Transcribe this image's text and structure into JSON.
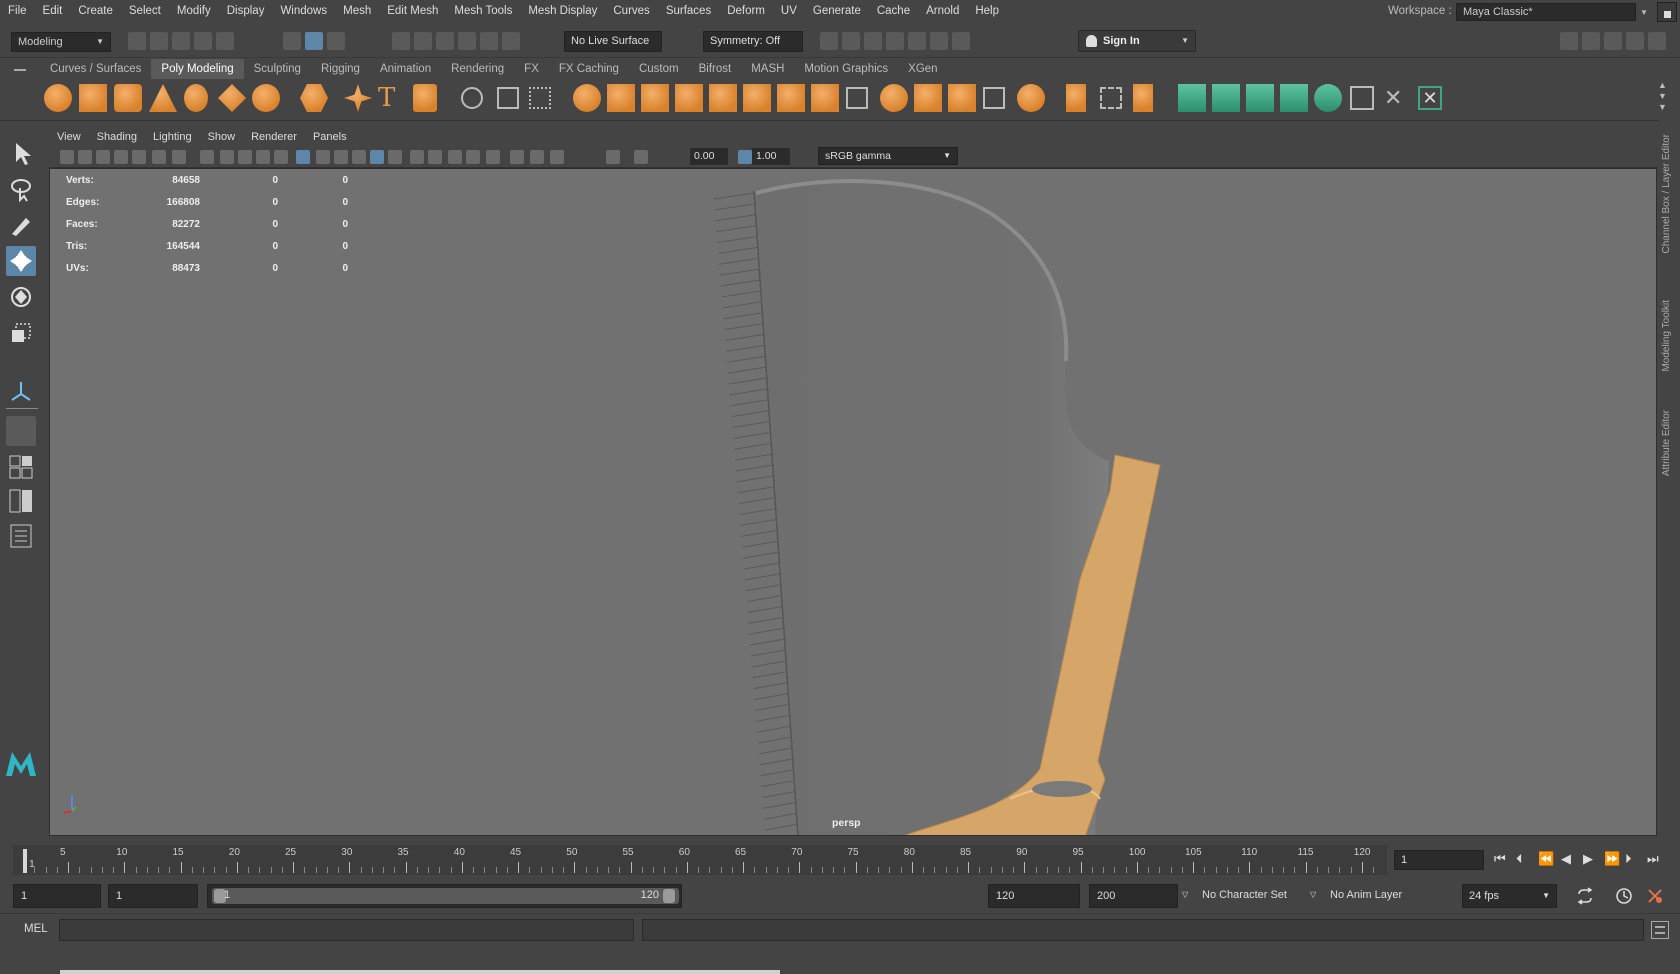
{
  "menu": [
    "File",
    "Edit",
    "Create",
    "Select",
    "Modify",
    "Display",
    "Windows",
    "Mesh",
    "Edit Mesh",
    "Mesh Tools",
    "Mesh Display",
    "Curves",
    "Surfaces",
    "Deform",
    "UV",
    "Generate",
    "Cache",
    "Arnold",
    "Help"
  ],
  "workspace": {
    "label": "Workspace :",
    "value": "Maya Classic*"
  },
  "status_line": {
    "mode": "Modeling",
    "live_surface": "No Live Surface",
    "symmetry": "Symmetry: Off",
    "sign_in": "Sign In"
  },
  "shelf_tabs": [
    "Curves / Surfaces",
    "Poly Modeling",
    "Sculpting",
    "Rigging",
    "Animation",
    "Rendering",
    "FX",
    "FX Caching",
    "Custom",
    "Bifrost",
    "MASH",
    "Motion Graphics",
    "XGen"
  ],
  "active_shelf_tab": "Poly Modeling",
  "panel_menu": [
    "View",
    "Shading",
    "Lighting",
    "Show",
    "Renderer",
    "Panels"
  ],
  "viewport_toolbar": {
    "exposure": "0.00",
    "gamma": "1.00",
    "color_space": "sRGB gamma"
  },
  "hud": [
    {
      "label": "Verts:",
      "v1": "84658",
      "v2": "0",
      "v3": "0"
    },
    {
      "label": "Edges:",
      "v1": "166808",
      "v2": "0",
      "v3": "0"
    },
    {
      "label": "Faces:",
      "v1": "82272",
      "v2": "0",
      "v3": "0"
    },
    {
      "label": "Tris:",
      "v1": "164544",
      "v2": "0",
      "v3": "0"
    },
    {
      "label": "UVs:",
      "v1": "88473",
      "v2": "0",
      "v3": "0"
    }
  ],
  "camera_label": "persp",
  "side_tabs": [
    "Channel Box / Layer Editor",
    "Modeling Toolkit",
    "Attribute Editor"
  ],
  "time_slider": {
    "ticks": [
      "5",
      "10",
      "15",
      "20",
      "25",
      "30",
      "35",
      "40",
      "45",
      "50",
      "55",
      "60",
      "65",
      "70",
      "75",
      "80",
      "85",
      "90",
      "95",
      "100",
      "105",
      "110",
      "115",
      "120"
    ],
    "current_frame_label": "1",
    "current_frame_field": "1"
  },
  "range": {
    "start": "1",
    "anim_start": "1",
    "slider_start": "1",
    "slider_end": "120",
    "end": "120",
    "anim_end": "200",
    "character_set": "No Character Set",
    "anim_layer": "No Anim Layer",
    "fps": "24 fps"
  },
  "command_line": {
    "label": "MEL"
  },
  "colors": {
    "viewport_bg": "#717171",
    "selected_tool": "#5d86a8",
    "mesh_highlight": "#d6a669",
    "shelf_orange": "#e59a45",
    "shelf_green": "#3fa585"
  }
}
